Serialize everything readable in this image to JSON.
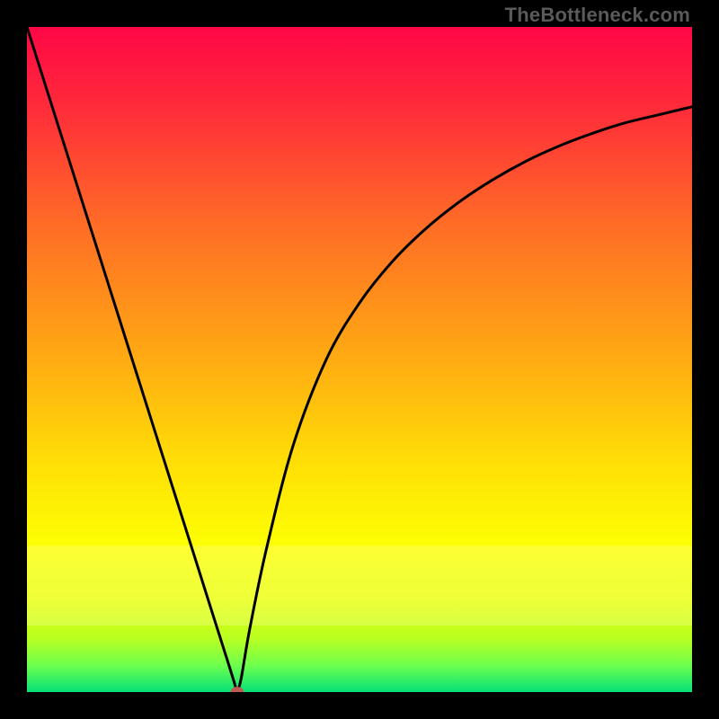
{
  "watermark": "TheBottleneck.com",
  "chart_data": {
    "type": "line",
    "title": "",
    "xlabel": "",
    "ylabel": "",
    "xlim": [
      0,
      1
    ],
    "ylim": [
      0,
      1
    ],
    "background_gradient": {
      "stops": [
        {
          "offset": 0.0,
          "color": "#ff0746"
        },
        {
          "offset": 0.12,
          "color": "#ff2b3a"
        },
        {
          "offset": 0.3,
          "color": "#ff6d26"
        },
        {
          "offset": 0.5,
          "color": "#ffab12"
        },
        {
          "offset": 0.66,
          "color": "#ffe006"
        },
        {
          "offset": 0.78,
          "color": "#fdff03"
        },
        {
          "offset": 0.86,
          "color": "#e7ff0a"
        },
        {
          "offset": 0.92,
          "color": "#b9ff22"
        },
        {
          "offset": 0.96,
          "color": "#6dff4d"
        },
        {
          "offset": 1.0,
          "color": "#05e17a"
        }
      ],
      "pale_band": {
        "top": 0.78,
        "bottom": 0.9,
        "color": "#ffffb0",
        "opacity": 0.28
      }
    },
    "series": [
      {
        "name": "curve",
        "x": [
          0.0,
          0.05,
          0.1,
          0.15,
          0.2,
          0.25,
          0.28,
          0.3,
          0.31,
          0.316,
          0.322,
          0.335,
          0.36,
          0.4,
          0.45,
          0.5,
          0.55,
          0.6,
          0.65,
          0.7,
          0.75,
          0.8,
          0.85,
          0.9,
          0.95,
          1.0
        ],
        "values": [
          1.0,
          0.842,
          0.684,
          0.526,
          0.368,
          0.21,
          0.115,
          0.052,
          0.02,
          0.0,
          0.02,
          0.095,
          0.215,
          0.37,
          0.5,
          0.585,
          0.648,
          0.697,
          0.737,
          0.77,
          0.798,
          0.821,
          0.84,
          0.856,
          0.868,
          0.88
        ]
      }
    ],
    "marker": {
      "x": 0.316,
      "y": 0.0,
      "rx": 0.01,
      "ry": 0.008,
      "color": "#c15a55"
    }
  }
}
